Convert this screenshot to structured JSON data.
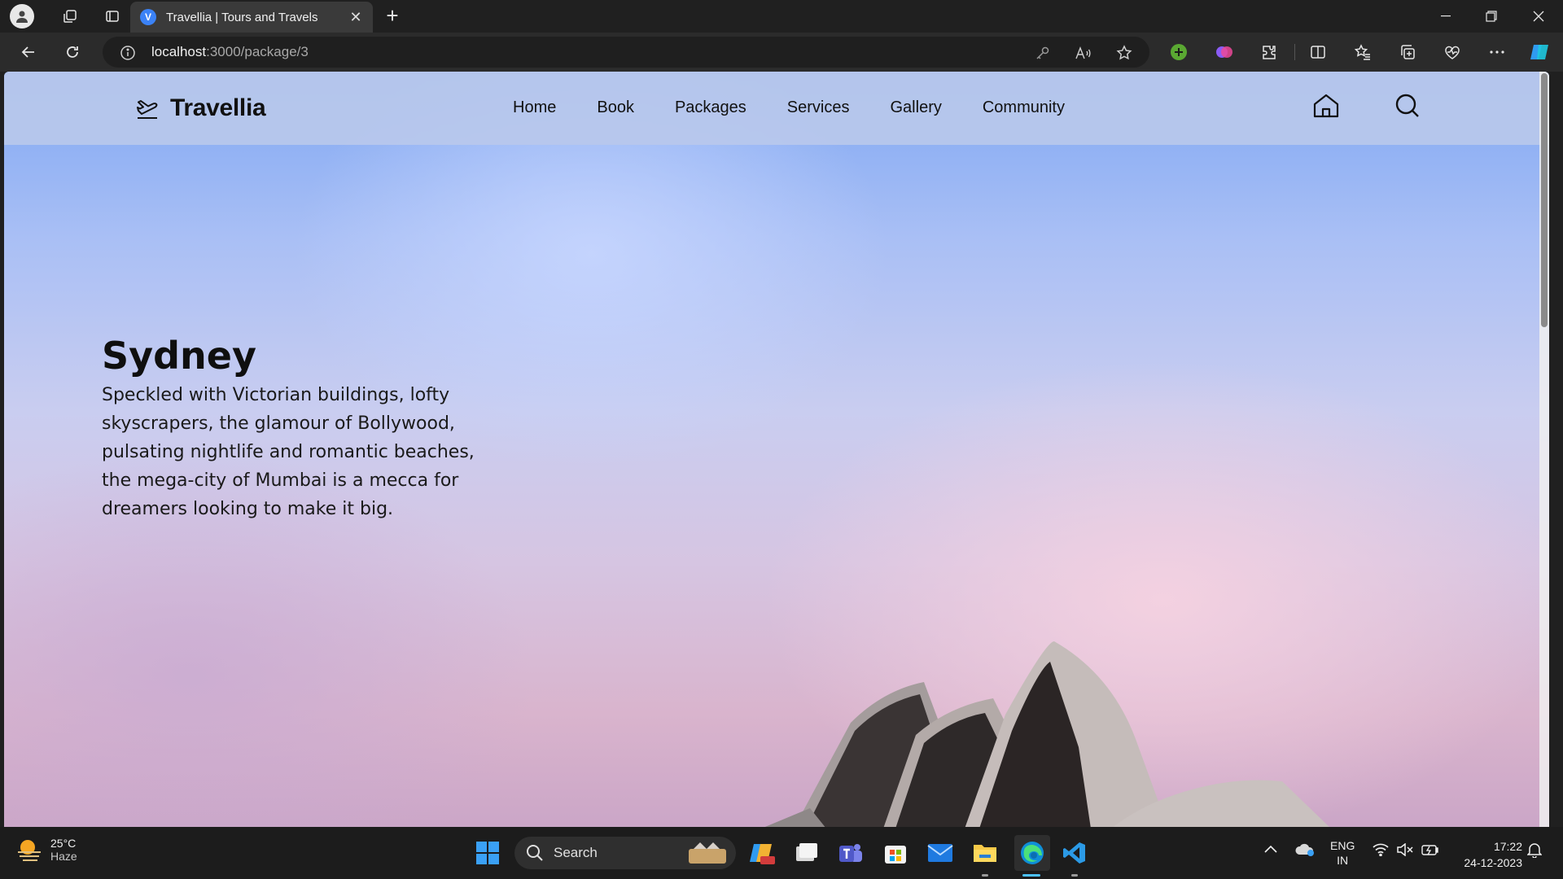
{
  "browser": {
    "tab": {
      "title": "Travellia | Tours and Travels",
      "favicon_letter": "V"
    },
    "address": {
      "host": "localhost",
      "path": ":3000/package/3"
    },
    "icons": [
      "profile-icon",
      "workspaces-icon",
      "tab-actions-icon",
      "back-icon",
      "refresh-icon",
      "site-info-icon",
      "key-icon",
      "read-aloud-icon",
      "favorite-star-icon",
      "extension-add-icon",
      "extension-brain-icon",
      "extensions-icon",
      "split-screen-icon",
      "favorites-icon",
      "collections-icon",
      "browser-essentials-icon",
      "more-icon",
      "copilot-icon"
    ]
  },
  "site": {
    "brand": "Travellia",
    "menu": [
      "Home",
      "Book",
      "Packages",
      "Services",
      "Gallery",
      "Community"
    ],
    "hero": {
      "title": "Sydney",
      "description": "Speckled with Victorian buildings, lofty skyscrapers, the glamour of Bollywood, pulsating nightlife and romantic beaches, the mega-city of Mumbai is a mecca for dreamers looking to make it big."
    }
  },
  "taskbar": {
    "weather": {
      "temp": "25°C",
      "condition": "Haze"
    },
    "search_label": "Search",
    "language": {
      "line1": "ENG",
      "line2": "IN"
    },
    "time": "17:22",
    "date": "24-12-2023"
  },
  "colors": {
    "accent": "#3b82f6",
    "nav_bg": "#b9c8eb",
    "text": "#111111"
  }
}
